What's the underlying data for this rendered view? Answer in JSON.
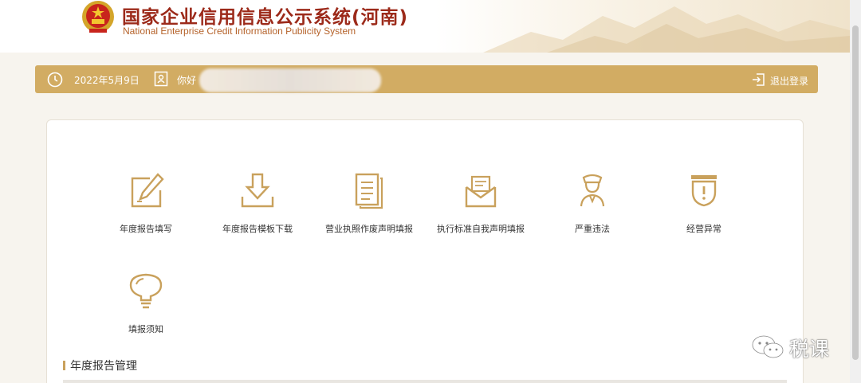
{
  "header": {
    "title_cn": "国家企业信用信息公示系统(河南)",
    "title_en": "National Enterprise Credit Information Publicity System"
  },
  "topbar": {
    "date": "2022年5月9日",
    "greeting": "你好",
    "logout_label": "退出登录"
  },
  "tiles": [
    {
      "label": "年度报告填写",
      "icon": "pencil-edit-icon"
    },
    {
      "label": "年度报告模板下载",
      "icon": "download-icon"
    },
    {
      "label": "营业执照作废声明填报",
      "icon": "document-icon"
    },
    {
      "label": "执行标准自我声明填报",
      "icon": "mail-envelope-icon"
    },
    {
      "label": "严重违法",
      "icon": "officer-icon"
    },
    {
      "label": "经营异常",
      "icon": "warning-shield-icon"
    },
    {
      "label": "填报须知",
      "icon": "lightbulb-icon"
    }
  ],
  "section": {
    "title": "年度报告管理"
  },
  "watermark": {
    "text": "税课"
  },
  "colors": {
    "accent": "#d2ac63",
    "icon": "#c9a15c",
    "title_red": "#9c2a1a"
  }
}
